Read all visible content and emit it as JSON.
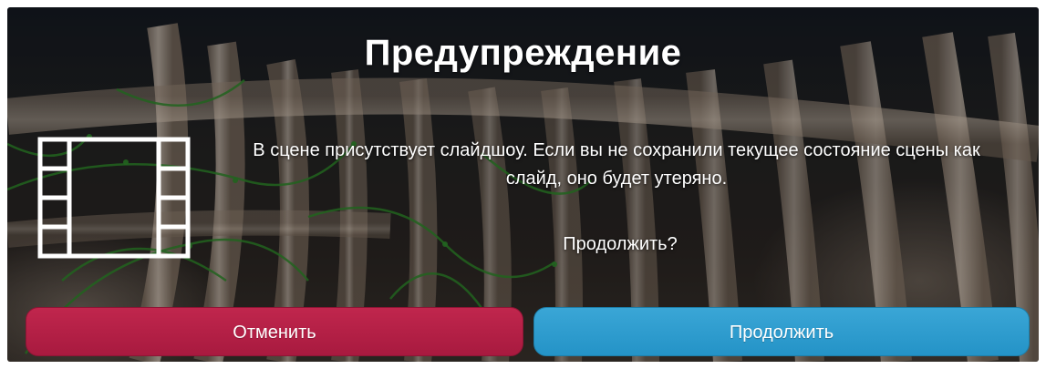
{
  "dialog": {
    "title": "Предупреждение",
    "message": "В сцене присутствует слайдшоу. Если вы не сохранили текущее состояние сцены как слайд, оно будет утеряно.",
    "question": "Продолжить?",
    "cancel_label": "Отменить",
    "continue_label": "Продолжить",
    "icon": "slideshow-filmstrip-icon"
  },
  "colors": {
    "cancel": "#b81f46",
    "continue": "#2e9ccf",
    "text": "#ffffff"
  }
}
